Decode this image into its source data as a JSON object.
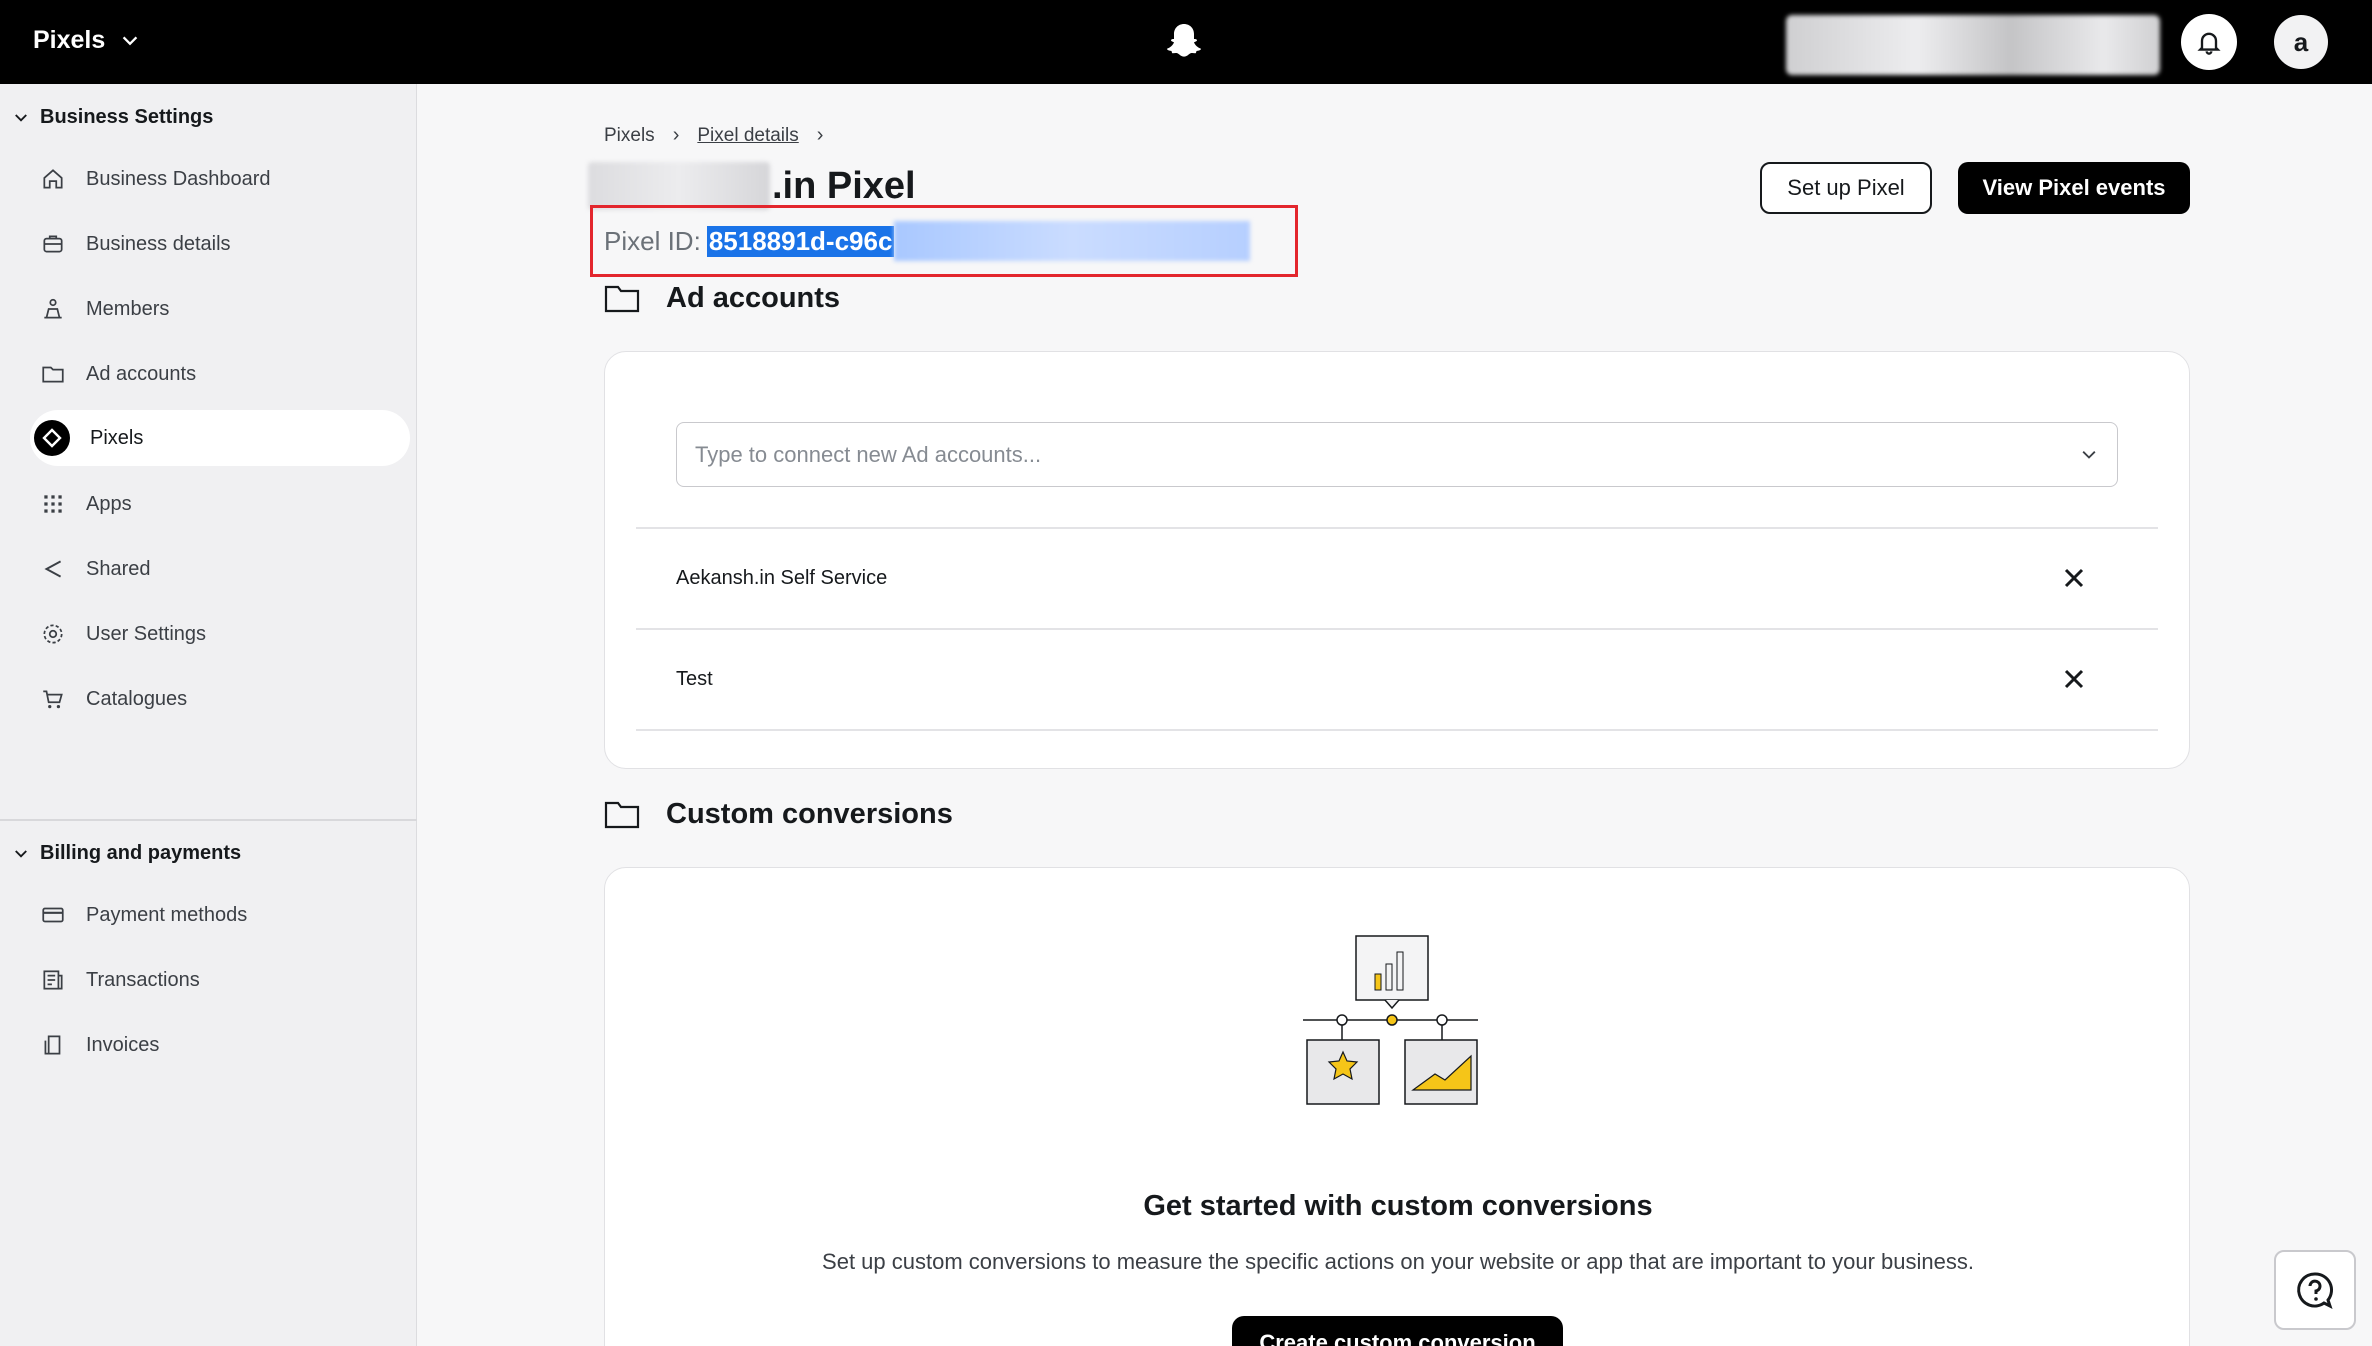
{
  "topbar": {
    "app_name": "Pixels",
    "avatar_initial": "a"
  },
  "sidebar": {
    "sections": [
      {
        "title": "Business Settings",
        "items": [
          {
            "label": "Business Dashboard",
            "icon": "home-icon"
          },
          {
            "label": "Business details",
            "icon": "briefcase-icon"
          },
          {
            "label": "Members",
            "icon": "members-icon"
          },
          {
            "label": "Ad accounts",
            "icon": "folder-icon"
          },
          {
            "label": "Pixels",
            "icon": "pixel-icon",
            "active": true
          },
          {
            "label": "Apps",
            "icon": "apps-grid-icon"
          },
          {
            "label": "Shared",
            "icon": "share-icon"
          },
          {
            "label": "User Settings",
            "icon": "gear-icon"
          },
          {
            "label": "Catalogues",
            "icon": "cart-icon"
          }
        ]
      },
      {
        "title": "Billing and payments",
        "items": [
          {
            "label": "Payment methods",
            "icon": "credit-card-icon"
          },
          {
            "label": "Transactions",
            "icon": "receipt-icon"
          },
          {
            "label": "Invoices",
            "icon": "invoice-icon"
          }
        ]
      }
    ]
  },
  "breadcrumb": {
    "root": "Pixels",
    "current": "Pixel details"
  },
  "page": {
    "title_suffix": ".in Pixel",
    "pixel_id_label": "Pixel ID:",
    "pixel_id_value": "8518891d-c96c",
    "setup_button": "Set up Pixel",
    "view_events_button": "View Pixel events"
  },
  "ad_accounts": {
    "title": "Ad accounts",
    "input_placeholder": "Type to connect new Ad accounts...",
    "rows": [
      {
        "name": "Aekansh.in Self Service"
      },
      {
        "name": "Test"
      }
    ]
  },
  "custom_conversions": {
    "title": "Custom conversions",
    "empty_title": "Get started with custom conversions",
    "empty_subtitle": "Set up custom conversions to measure the specific actions on your website or app that are important to your business.",
    "create_button": "Create custom conversion"
  },
  "colors": {
    "topbar": "#000000",
    "highlight": "#1a73e8",
    "annotation_box": "#e3262d",
    "accent_yellow": "#f5c518"
  }
}
